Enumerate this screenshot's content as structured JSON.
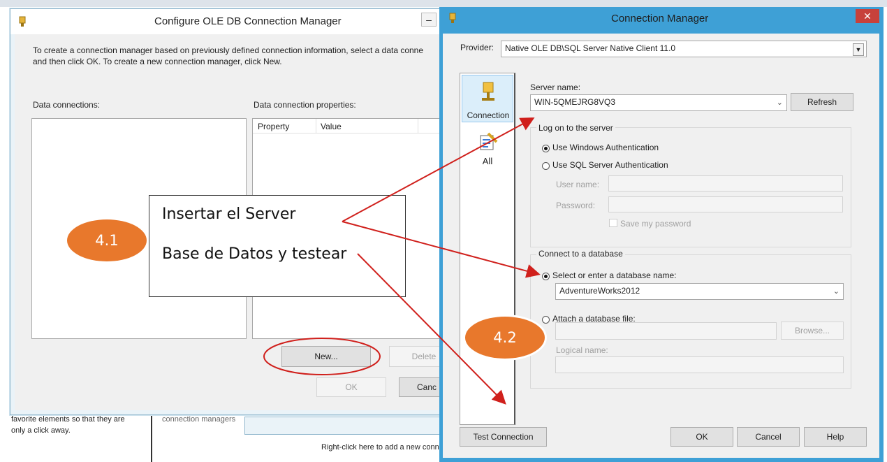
{
  "background": {
    "tip_text": "favorite elements so that they are",
    "tip_text2": "only a click away.",
    "mid_text": "connection managers",
    "footer_text": "Right-click here to add a new conn"
  },
  "configure_window": {
    "title": "Configure OLE DB Connection Manager",
    "minimize_label": "–",
    "instructions_line1": "To create a connection manager based on previously defined connection information, select a data conne",
    "instructions_line2": "and then click OK. To create a new connection manager, click New.",
    "data_connections_label": "Data connections:",
    "properties_label": "Data connection properties:",
    "columns": [
      "Property",
      "Value"
    ],
    "new_button": "New...",
    "delete_button": "Delete",
    "ok_button": "OK",
    "cancel_button": "Canc"
  },
  "connection_manager": {
    "title": "Connection Manager",
    "close_label": "✕",
    "provider_label": "Provider:",
    "provider_value": "Native OLE DB\\SQL Server Native Client 11.0",
    "nav": [
      {
        "label": "Connection",
        "icon": "database-icon"
      },
      {
        "label": "All",
        "icon": "properties-icon"
      }
    ],
    "server_name_label": "Server name:",
    "server_name_value": "WIN-5QMEJRG8VQ3",
    "refresh_button": "Refresh",
    "logon_group": "Log on to the server",
    "auth_windows": "Use Windows Authentication",
    "auth_sql": "Use SQL Server Authentication",
    "username_label": "User name:",
    "password_label": "Password:",
    "save_password": "Save my password",
    "db_group": "Connect to a database",
    "select_db_label": "Select or enter a database name:",
    "db_value": "AdventureWorks2012",
    "attach_label": "Attach a database file:",
    "browse_button": "Browse...",
    "logical_name_label": "Logical name:",
    "test_button": "Test Connection",
    "ok_button": "OK",
    "cancel_button": "Cancel",
    "help_button": "Help"
  },
  "annotation": {
    "line1": "Insertar el Server",
    "line2": "Base de Datos y testear",
    "badge1": "4.1",
    "badge2": "4.2",
    "arrow_color": "#d0201c",
    "badge_color": "#e8782c"
  }
}
